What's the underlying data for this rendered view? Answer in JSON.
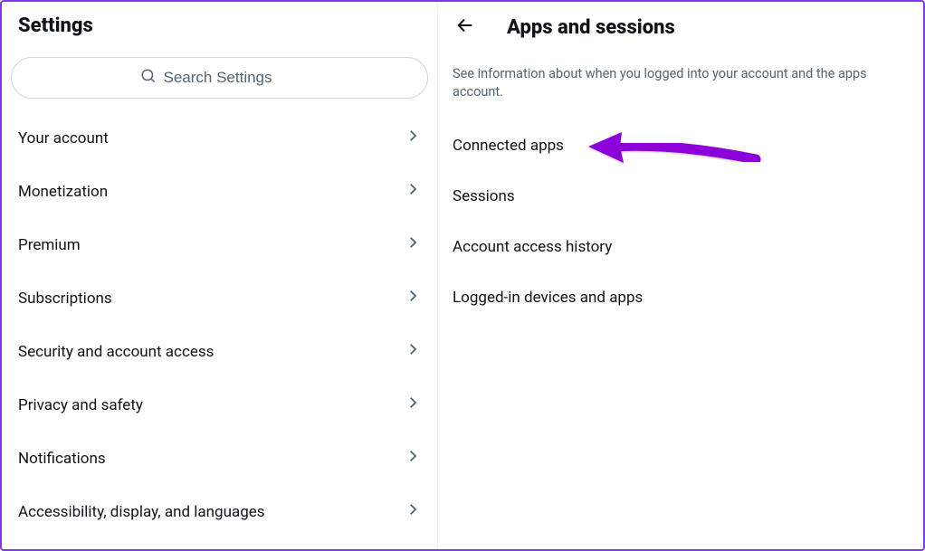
{
  "left": {
    "title": "Settings",
    "search_placeholder": "Search Settings",
    "items": [
      {
        "label": "Your account"
      },
      {
        "label": "Monetization"
      },
      {
        "label": "Premium"
      },
      {
        "label": "Subscriptions"
      },
      {
        "label": "Security and account access"
      },
      {
        "label": "Privacy and safety"
      },
      {
        "label": "Notifications"
      },
      {
        "label": "Accessibility, display, and languages"
      }
    ]
  },
  "right": {
    "title": "Apps and sessions",
    "description": "See information about when you logged into your account and the apps account.",
    "items": [
      {
        "label": "Connected apps"
      },
      {
        "label": "Sessions"
      },
      {
        "label": "Account access history"
      },
      {
        "label": "Logged-in devices and apps"
      }
    ]
  }
}
